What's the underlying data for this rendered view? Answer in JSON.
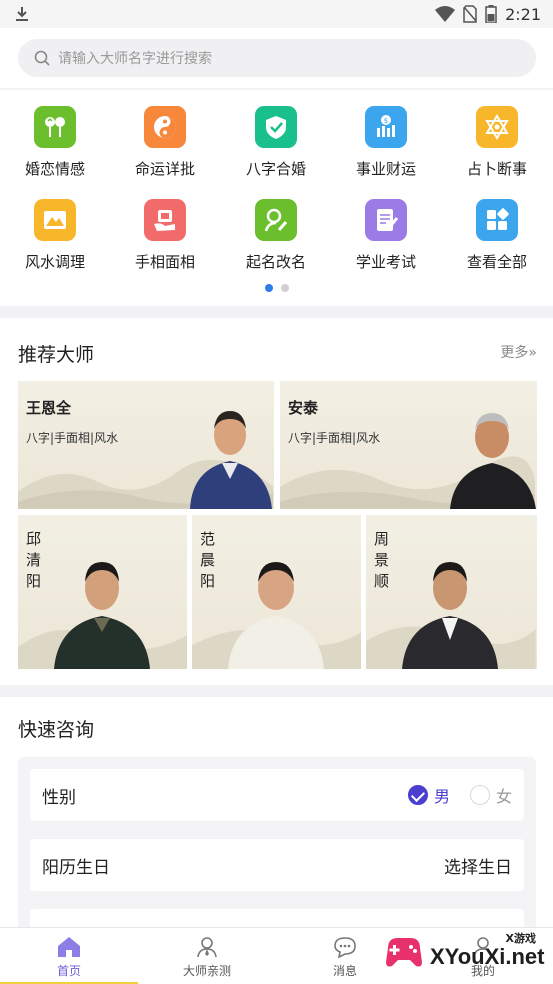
{
  "status_bar": {
    "time": "2:21"
  },
  "search": {
    "placeholder": "请输入大师名字进行搜索"
  },
  "categories": [
    {
      "label": "婚恋情感",
      "color": "#6cbf2c",
      "icon": "love-balloons-icon"
    },
    {
      "label": "命运详批",
      "color": "#f7873a",
      "icon": "yin-yang-icon"
    },
    {
      "label": "八字合婚",
      "color": "#19c08c",
      "icon": "marriage-shield-icon"
    },
    {
      "label": "事业财运",
      "color": "#3ba5ee",
      "icon": "money-chart-icon"
    },
    {
      "label": "占卜断事",
      "color": "#f8b62b",
      "icon": "hexagram-icon"
    },
    {
      "label": "风水调理",
      "color": "#f8b62b",
      "icon": "mountain-icon"
    },
    {
      "label": "手相面相",
      "color": "#f26b6b",
      "icon": "palm-icon"
    },
    {
      "label": "起名改名",
      "color": "#6cbf2c",
      "icon": "pen-person-icon"
    },
    {
      "label": "学业考试",
      "color": "#9b7be6",
      "icon": "exam-paper-icon"
    },
    {
      "label": "查看全部",
      "color": "#3ba5ee",
      "icon": "all-grid-icon"
    }
  ],
  "recommend": {
    "title": "推荐大师",
    "more": "更多»",
    "masters_top": [
      {
        "name": "王恩全",
        "tags": "八字|手面相|风水"
      },
      {
        "name": "安泰",
        "tags": "八字|手面相|风水"
      }
    ],
    "masters_bottom": [
      {
        "name": "邱清阳"
      },
      {
        "name": "范晨阳"
      },
      {
        "name": "周景顺"
      }
    ]
  },
  "consult": {
    "title": "快速咨询",
    "gender_label": "性别",
    "gender_male": "男",
    "gender_female": "女",
    "birthday_label": "阳历生日",
    "birthday_value": "选择生日"
  },
  "tabbar": [
    {
      "label": "首页"
    },
    {
      "label": "大师亲测"
    },
    {
      "label": "消息"
    },
    {
      "label": "我的"
    }
  ],
  "watermark": {
    "small": "X游戏",
    "big": "XYouXi.net"
  },
  "colors": {
    "accent": "#4b3fd1",
    "tab_active": "#6b5fd8",
    "tab_underline": "#f3d03a",
    "pager_active": "#2f7be8"
  }
}
